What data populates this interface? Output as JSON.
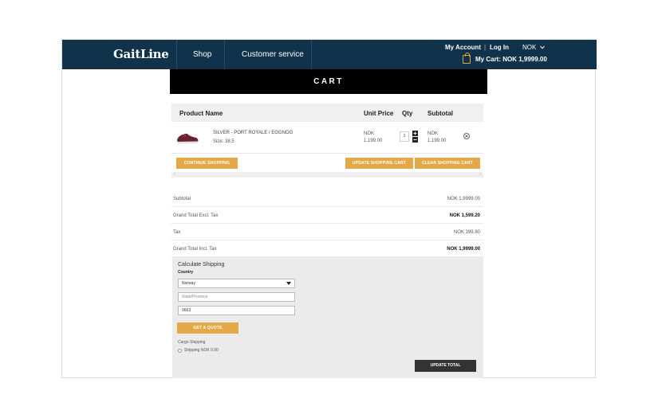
{
  "header": {
    "logo": "GaitLine",
    "nav": [
      "Shop",
      "Customer service"
    ],
    "my_account": "My Account",
    "separator": "|",
    "log_in": "Log In",
    "currency": "NOK",
    "cart_label": "My Cart: NOK 1,9999.00"
  },
  "cart": {
    "title": "CART",
    "columns": [
      "Product Name",
      "Unit Price",
      "Qty",
      "Subtotal"
    ],
    "item": {
      "name": "SILVER - PORT ROYALE / EGGNOG",
      "size": "Size:   38,5",
      "unit_price_currency": "NOK",
      "unit_price_amount": "1,199.00",
      "qty": "1",
      "subtotal_currency": "NOK",
      "subtotal_amount": "1,199.00"
    },
    "buttons": {
      "continue": "CONTINUE SHOPPING",
      "update": "UPDATE SHOPPING CART",
      "clear": "CLEAR SHOPPING CART"
    }
  },
  "totals": [
    {
      "label": "Subtotal",
      "value": "NOK 1,9999.00",
      "bold": false
    },
    {
      "label": "Grand Total Excl. Tax",
      "value": "NOK 1,599.20",
      "bold": true
    },
    {
      "label": "Tax",
      "value": "NOK 399.80",
      "bold": false
    },
    {
      "label": "Grand Total Incl. Tax",
      "value": "NOK 1,9999.00",
      "bold": true
    }
  ],
  "shipping": {
    "title": "Calculate Shipping",
    "country_label": "Country",
    "country_value": "Norway",
    "state_placeholder": "State/Province",
    "zip_value": "0663",
    "quote_button": "GET A QUOTE",
    "cargo_label": "Cargo Shipping",
    "option_label": "Shipping NOK 0.00",
    "update_total_button": "UPDATE TOTAL"
  },
  "colors": {
    "header_bg": "#10324a",
    "accent": "#e3a847",
    "title_bg": "#000000"
  }
}
